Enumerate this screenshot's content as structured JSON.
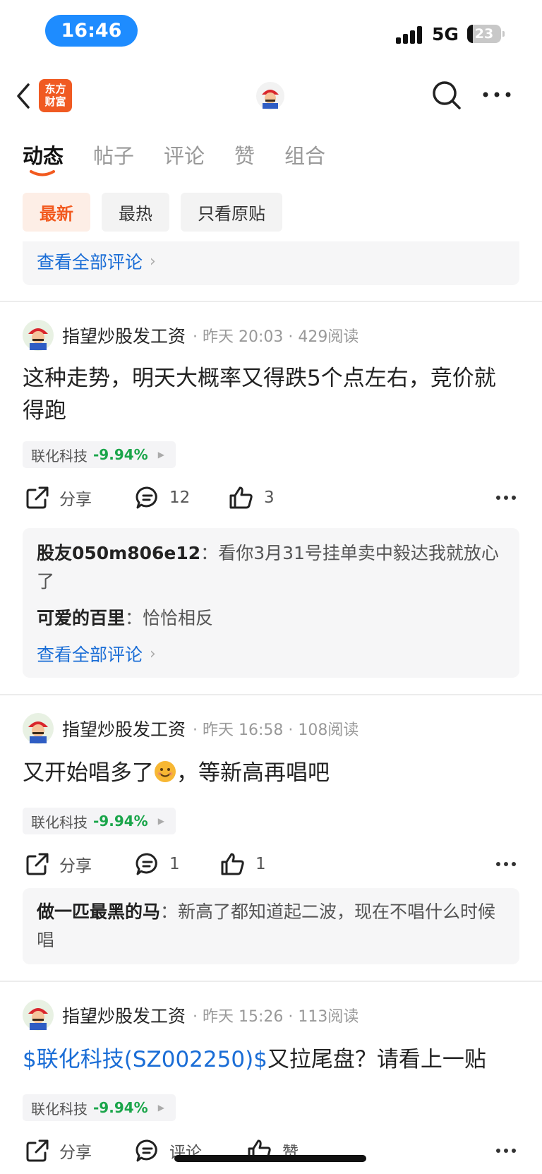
{
  "status": {
    "time": "16:46",
    "network": "5G",
    "battery": "23"
  },
  "header": {
    "logo_text_1": "东方",
    "logo_text_2": "财富"
  },
  "tabs": [
    {
      "label": "动态",
      "active": true
    },
    {
      "label": "帖子",
      "active": false
    },
    {
      "label": "评论",
      "active": false
    },
    {
      "label": "赞",
      "active": false
    },
    {
      "label": "组合",
      "active": false
    }
  ],
  "filters": [
    {
      "label": "最新",
      "active": true
    },
    {
      "label": "最热",
      "active": false
    },
    {
      "label": "只看原贴",
      "active": false
    }
  ],
  "view_all_label": "查看全部评论",
  "posts": [
    {
      "user": "指望炒股发工资",
      "time": "昨天 20:03",
      "reads": "429阅读",
      "text": "这种走势，明天大概率又得跌5个点左右，竞价就得跑",
      "stock": {
        "name": "联化科技",
        "change": "-9.94%"
      },
      "share_label": "分享",
      "comments": "12",
      "likes": "3",
      "replies": [
        {
          "user": "股友050m806e12",
          "text": "看你3月31号挂单卖中毅达我就放心了"
        },
        {
          "user": "可爱的百里",
          "text": "恰恰相反"
        }
      ]
    },
    {
      "user": "指望炒股发工资",
      "time": "昨天 16:58",
      "reads": "108阅读",
      "text_before": "又开始唱多了",
      "text_after": "，等新高再唱吧",
      "stock": {
        "name": "联化科技",
        "change": "-9.94%"
      },
      "share_label": "分享",
      "comments": "1",
      "likes": "1",
      "replies": [
        {
          "user": "做一匹最黑的马",
          "text": "新高了都知道起二波，现在不唱什么时候唱"
        }
      ]
    },
    {
      "user": "指望炒股发工资",
      "time": "昨天 15:26",
      "reads": "113阅读",
      "link": "$联化科技(SZ002250)$",
      "text": "又拉尾盘？请看上一贴",
      "stock": {
        "name": "联化科技",
        "change": "-9.94%"
      },
      "share_label": "分享",
      "comments": "评论",
      "likes": "赞"
    }
  ]
}
